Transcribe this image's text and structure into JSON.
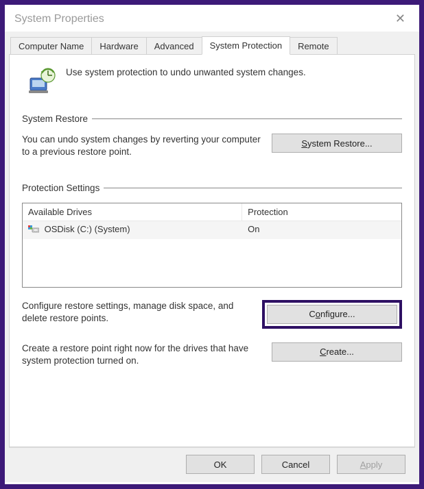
{
  "window": {
    "title": "System Properties"
  },
  "tabs": [
    {
      "label": "Computer Name",
      "active": false
    },
    {
      "label": "Hardware",
      "active": false
    },
    {
      "label": "Advanced",
      "active": false
    },
    {
      "label": "System Protection",
      "active": true
    },
    {
      "label": "Remote",
      "active": false
    }
  ],
  "intro_text": "Use system protection to undo unwanted system changes.",
  "restore": {
    "group_label": "System Restore",
    "desc": "You can undo system changes by reverting your computer to a previous restore point.",
    "button": "System Restore..."
  },
  "protection": {
    "group_label": "Protection Settings",
    "col_drive": "Available Drives",
    "col_protection": "Protection",
    "rows": [
      {
        "drive": "OSDisk (C:) (System)",
        "protection": "On"
      }
    ],
    "configure_desc": "Configure restore settings, manage disk space, and delete restore points.",
    "configure_button": "Configure...",
    "create_desc": "Create a restore point right now for the drives that have system protection turned on.",
    "create_button": "Create..."
  },
  "footer": {
    "ok": "OK",
    "cancel": "Cancel",
    "apply": "Apply"
  }
}
